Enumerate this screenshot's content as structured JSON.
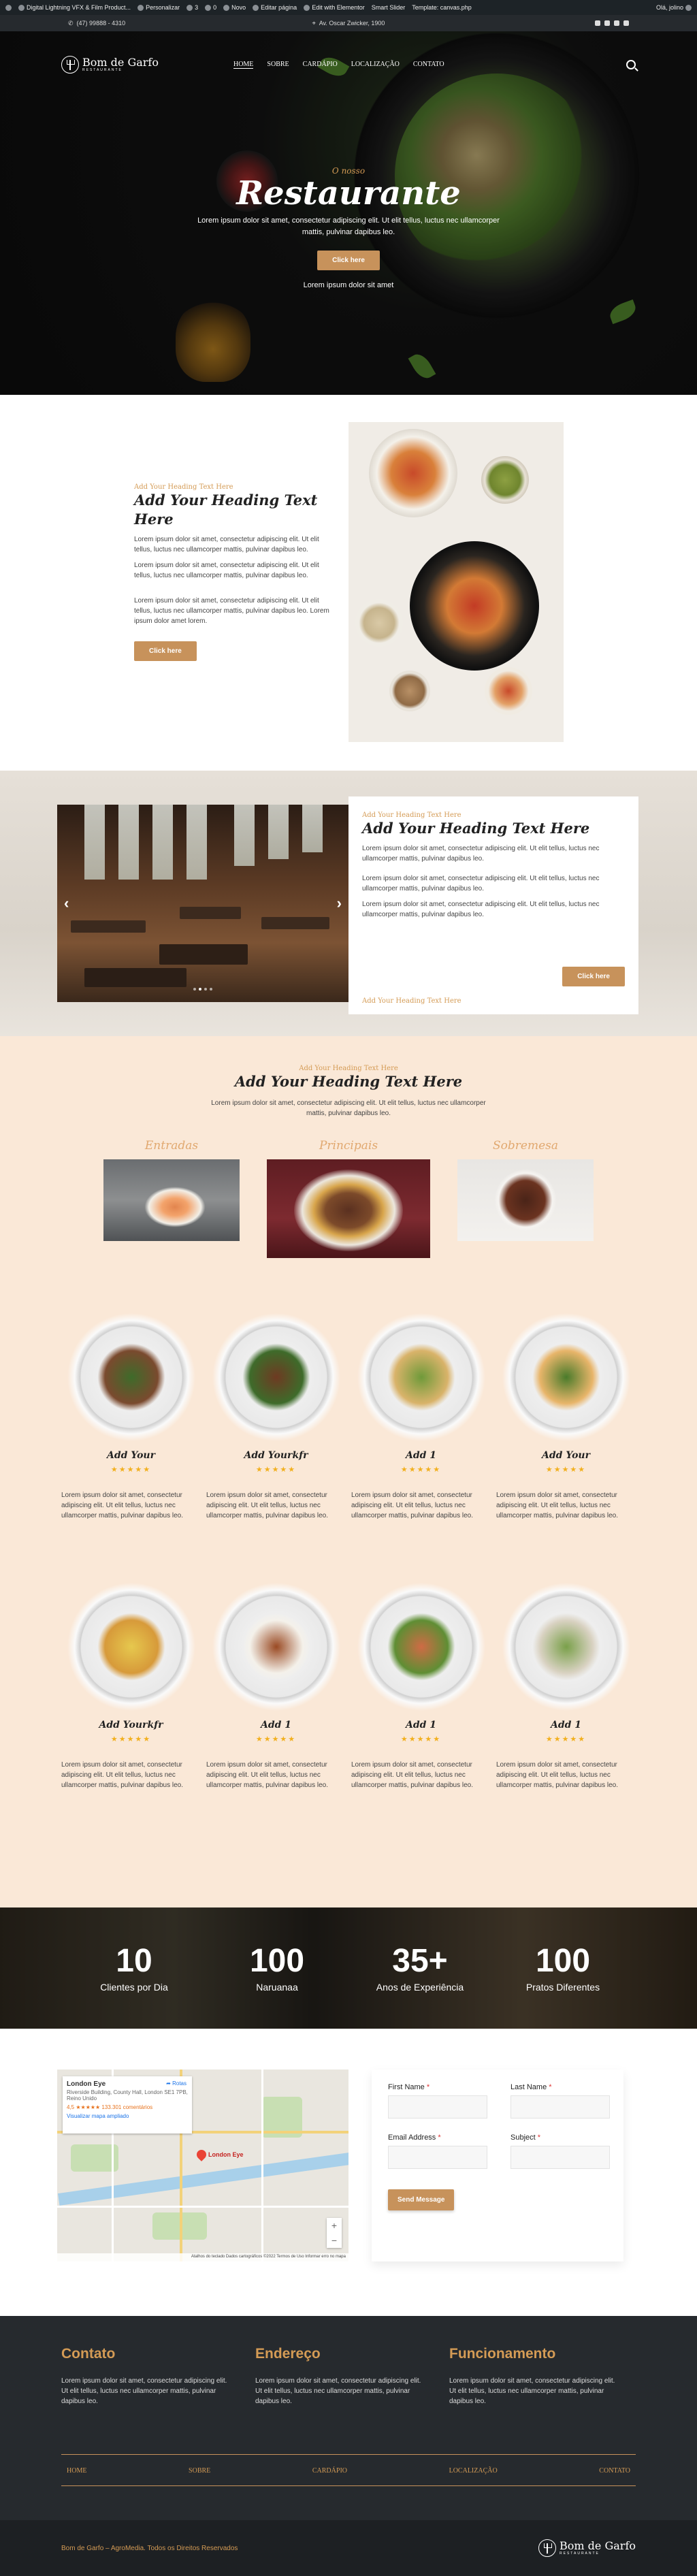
{
  "adminbar": {
    "items": [
      "Digital Lightning VFX & Film Product...",
      "Personalizar",
      "3",
      "0",
      "Novo",
      "Editar página",
      "Edit with Elementor",
      "Smart Slider",
      "Template: canvas.php"
    ],
    "greeting": "Olá, jolino"
  },
  "topbar": {
    "phone": "(47) 99888 - 4310",
    "address": "Av. Oscar Zwicker, 1900",
    "social_icons": [
      "facebook-icon",
      "twitter-icon",
      "instagram-icon",
      "youtube-icon"
    ]
  },
  "logo": {
    "name": "Bom de Garfo",
    "sub": "RESTAURANTE"
  },
  "nav": [
    "HOME",
    "SOBRE",
    "CARDÁPIO",
    "LOCALIZAÇÃO",
    "CONTATO"
  ],
  "hero": {
    "kicker": "O nosso",
    "title": "Restaurante",
    "text": "Lorem ipsum dolor sit amet, consectetur adipiscing elit. Ut elit tellus, luctus nec ullamcorper mattis, pulvinar dapibus leo.",
    "button": "Click here",
    "sub": "Lorem ipsum dolor sit amet"
  },
  "about": {
    "kicker": "Add Your Heading Text Here",
    "heading": "Add Your Heading Text Here",
    "para1": "Lorem ipsum dolor sit amet, consectetur adipiscing elit. Ut elit tellus, luctus nec ullamcorper mattis, pulvinar dapibus leo.",
    "para2": "Lorem ipsum dolor sit amet, consectetur adipiscing elit. Ut elit tellus, luctus nec ullamcorper mattis, pulvinar dapibus leo.",
    "para3": "Lorem ipsum dolor sit amet, consectetur adipiscing elit. Ut elit tellus, luctus nec ullamcorper mattis, pulvinar dapibus leo. Lorem ipsum dolor amet lorem.",
    "button": "Click here"
  },
  "restaurant": {
    "kicker": "Add Your Heading Text Here",
    "heading": "Add Your Heading Text Here",
    "para1": "Lorem ipsum dolor sit amet, consectetur adipiscing elit. Ut elit tellus, luctus nec ullamcorper mattis, pulvinar dapibus leo.",
    "para2": "Lorem ipsum dolor sit amet, consectetur adipiscing elit. Ut elit tellus, luctus nec ullamcorper mattis, pulvinar dapibus leo.",
    "para3": "Lorem ipsum dolor sit amet, consectetur adipiscing elit. Ut elit tellus, luctus nec ullamcorper mattis, pulvinar dapibus leo.",
    "button": "Click here",
    "kicker_bottom": "Add Your Heading Text Here",
    "prev_arrow": "‹",
    "next_arrow": "›",
    "slides": 4,
    "active_slide": 2
  },
  "menu_section": {
    "kicker": "Add Your Heading Text Here",
    "heading": "Add Your Heading Text Here",
    "text": "Lorem ipsum dolor sit amet, consectetur adipiscing elit. Ut elit tellus, luctus nec ullamcorper mattis, pulvinar dapibus leo.",
    "categories": [
      "Entradas",
      "Principais",
      "Sobremesa"
    ]
  },
  "products": [
    {
      "name": "Add Your",
      "stars": "★★★★★",
      "text": "Lorem ipsum dolor sit amet, consectetur adipiscing elit. Ut elit tellus, luctus nec ullamcorper mattis, pulvinar dapibus leo."
    },
    {
      "name": "Add Yourkfr",
      "stars": "★★★★★",
      "text": "Lorem ipsum dolor sit amet, consectetur adipiscing elit. Ut elit tellus, luctus nec ullamcorper mattis, pulvinar dapibus leo."
    },
    {
      "name": "Add 1",
      "stars": "★★★★★",
      "text": "Lorem ipsum dolor sit amet, consectetur adipiscing elit. Ut elit tellus, luctus nec ullamcorper mattis, pulvinar dapibus leo."
    },
    {
      "name": "Add Your",
      "stars": "★★★★★",
      "text": "Lorem ipsum dolor sit amet, consectetur adipiscing elit. Ut elit tellus, luctus nec ullamcorper mattis, pulvinar dapibus leo."
    },
    {
      "name": "Add Yourkfr",
      "stars": "★★★★★",
      "text": "Lorem ipsum dolor sit amet, consectetur adipiscing elit. Ut elit tellus, luctus nec ullamcorper mattis, pulvinar dapibus leo."
    },
    {
      "name": "Add 1",
      "stars": "★★★★★",
      "text": "Lorem ipsum dolor sit amet, consectetur adipiscing elit. Ut elit tellus, luctus nec ullamcorper mattis, pulvinar dapibus leo."
    },
    {
      "name": "Add 1",
      "stars": "★★★★★",
      "text": "Lorem ipsum dolor sit amet, consectetur adipiscing elit. Ut elit tellus, luctus nec ullamcorper mattis, pulvinar dapibus leo."
    },
    {
      "name": "Add 1",
      "stars": "★★★★★",
      "text": "Lorem ipsum dolor sit amet, consectetur adipiscing elit. Ut elit tellus, luctus nec ullamcorper mattis, pulvinar dapibus leo."
    }
  ],
  "counters": [
    {
      "num": "10",
      "label": "Clientes por Dia"
    },
    {
      "num": "100",
      "label": "Naruanaa"
    },
    {
      "num": "35+",
      "label": "Anos de Experiência"
    },
    {
      "num": "100",
      "label": "Pratos Diferentes"
    }
  ],
  "map": {
    "title": "London Eye",
    "address": "Riverside Building, County Hall, London SE1 7PB, Reino Unido",
    "rating": "4,5 ★★★★★ 133.301 comentários",
    "link": "Visualizar mapa ampliado",
    "directions": "Rotas",
    "pin_label": "London Eye",
    "footer": "Atalhos do teclado   Dados cartográficos ©2022   Termos de Uso   Informar erro no mapa"
  },
  "form": {
    "first_name": "First Name",
    "last_name": "Last Name",
    "email": "Email Address",
    "subject": "Subject",
    "required_mark": "*",
    "button": "Send Message"
  },
  "footer": {
    "cols": [
      {
        "title": "Contato",
        "text": "Lorem ipsum dolor sit amet, consectetur adipiscing elit. Ut elit tellus, luctus nec ullamcorper mattis, pulvinar dapibus leo."
      },
      {
        "title": "Endereço",
        "text": "Lorem ipsum dolor sit amet, consectetur adipiscing elit. Ut elit tellus, luctus nec ullamcorper mattis, pulvinar dapibus leo."
      },
      {
        "title": "Funcionamento",
        "text": "Lorem ipsum dolor sit amet, consectetur adipiscing elit. Ut elit tellus, luctus nec ullamcorper mattis, pulvinar dapibus leo."
      }
    ],
    "menu": [
      "HOME",
      "SOBRE",
      "CARDÁPIO",
      "LOCALIZAÇÃO",
      "CONTATO"
    ],
    "copyright": "Bom de Garfo – AgroMedia. Todos os Direitos Reservados"
  },
  "colors": {
    "accent": "#c7925b",
    "kicker": "#d49b55",
    "cream": "#fae8d7",
    "dark": "#262a2e",
    "star": "#f2b01e"
  }
}
